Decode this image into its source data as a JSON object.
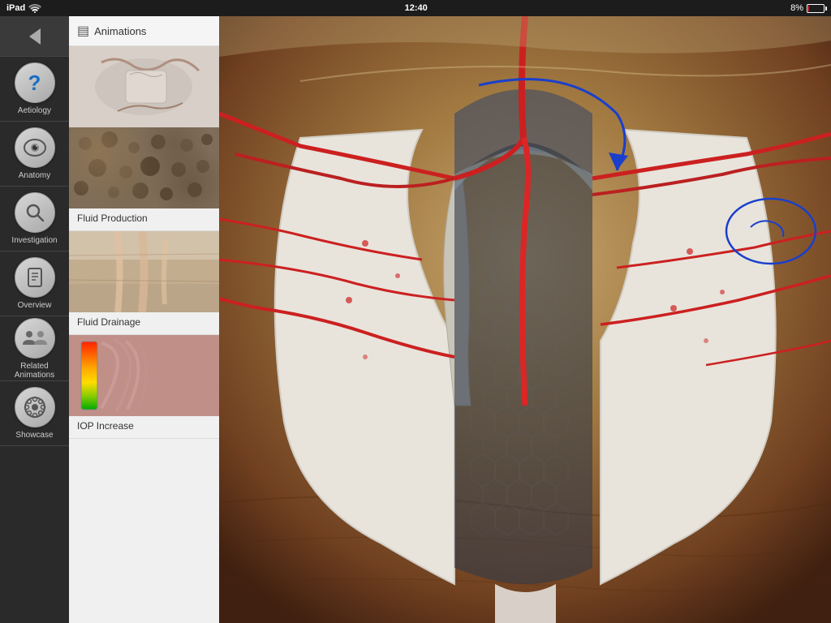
{
  "statusBar": {
    "carrier": "iPad",
    "wifi": true,
    "time": "12:40",
    "batteryPercent": "8%"
  },
  "sidebar": {
    "items": [
      {
        "id": "back",
        "label": ""
      },
      {
        "id": "aetiology",
        "label": "Aetiology"
      },
      {
        "id": "anatomy",
        "label": "Anatomy"
      },
      {
        "id": "investigation",
        "label": "Investigation"
      },
      {
        "id": "overview",
        "label": "Overview"
      },
      {
        "id": "related-animations",
        "label": "Related Animations"
      },
      {
        "id": "showcase",
        "label": "Showcase"
      }
    ]
  },
  "middlePanel": {
    "header": "Animations",
    "items": [
      {
        "id": "intro",
        "label": ""
      },
      {
        "id": "fluid-production",
        "label": "Fluid Production"
      },
      {
        "id": "fluid-drainage",
        "label": "Fluid Drainage"
      },
      {
        "id": "iop-increase",
        "label": "IOP Increase"
      }
    ]
  }
}
